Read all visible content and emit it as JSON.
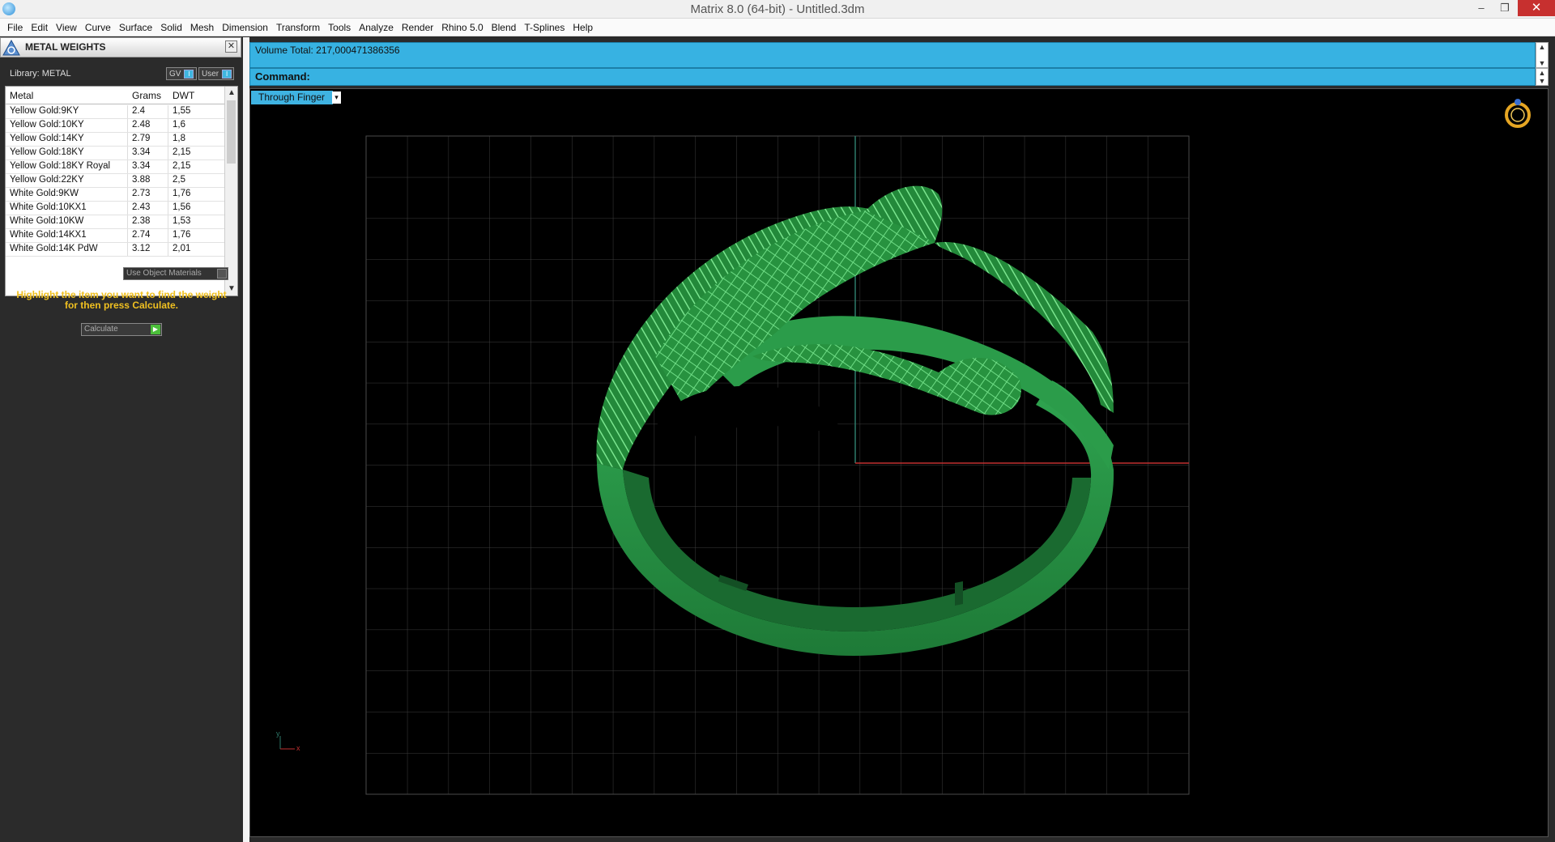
{
  "window": {
    "title": "Matrix 8.0 (64-bit) - Untitled.3dm",
    "minimize": "–",
    "restore": "❐",
    "close": "✕"
  },
  "menu": [
    "File",
    "Edit",
    "View",
    "Curve",
    "Surface",
    "Solid",
    "Mesh",
    "Dimension",
    "Transform",
    "Tools",
    "Analyze",
    "Render",
    "Rhino 5.0",
    "Blend",
    "T-Splines",
    "Help"
  ],
  "panel": {
    "title": "METAL WEIGHTS",
    "close": "✕",
    "library_label": "Library: METAL",
    "toggle_gv": "GV",
    "toggle_user": "User",
    "columns": [
      "Metal",
      "Grams",
      "DWT"
    ],
    "rows": [
      [
        "Yellow Gold:9KY",
        "2.4",
        "1,55"
      ],
      [
        "Yellow Gold:10KY",
        "2.48",
        "1,6"
      ],
      [
        "Yellow Gold:14KY",
        "2.79",
        "1,8"
      ],
      [
        "Yellow Gold:18KY",
        "3.34",
        "2,15"
      ],
      [
        "Yellow Gold:18KY Royal",
        "3.34",
        "2,15"
      ],
      [
        "Yellow Gold:22KY",
        "3.88",
        "2,5"
      ],
      [
        "White Gold:9KW",
        "2.73",
        "1,76"
      ],
      [
        "White Gold:10KX1",
        "2.43",
        "1,56"
      ],
      [
        "White Gold:10KW",
        "2.38",
        "1,53"
      ],
      [
        "White Gold:14KX1",
        "2.74",
        "1,76"
      ],
      [
        "White Gold:14K PdW",
        "3.12",
        "2,01"
      ]
    ],
    "use_object_materials": "Use Object Materials",
    "hint": "Highlight the item you want to find the weight for then press Calculate.",
    "calculate": "Calculate"
  },
  "command": {
    "volume_total": "Volume Total: 217,000471386356",
    "command_label": "Command:"
  },
  "viewport": {
    "label": "Through Finger",
    "axis_x": "x",
    "axis_y": "y"
  },
  "colors": {
    "accent": "#37b2e2",
    "ring": "#2a9a48",
    "grid": "#3a3a3a",
    "x_axis": "#c03030",
    "y_axis": "#2e7a6a",
    "hint": "#f0c020"
  }
}
